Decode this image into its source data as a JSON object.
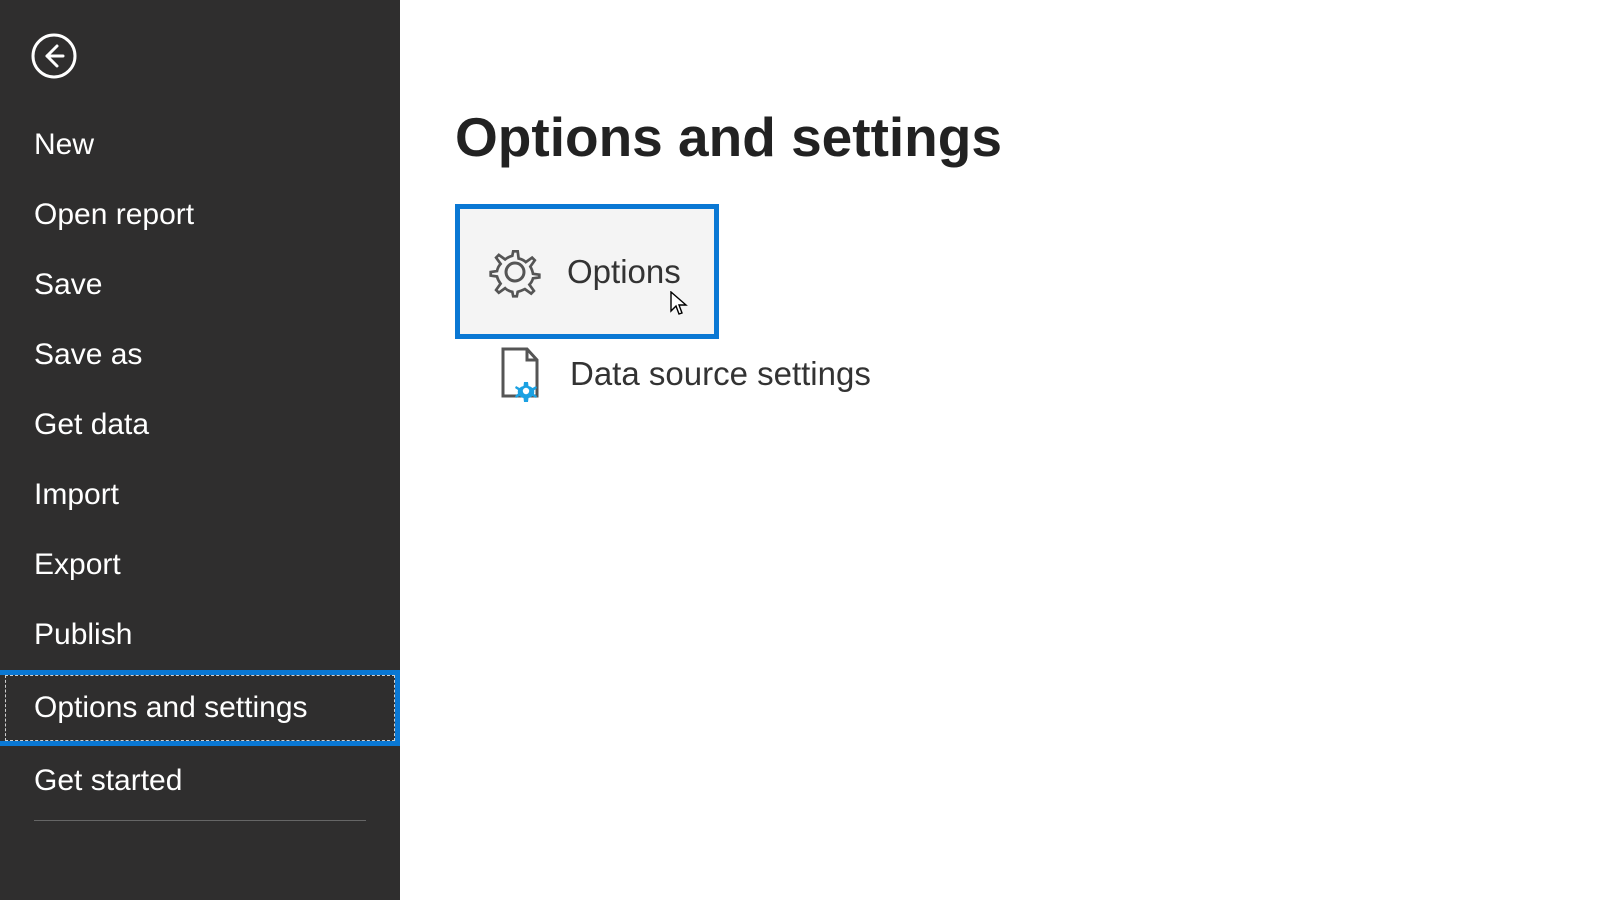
{
  "sidebar": {
    "items": [
      "New",
      "Open report",
      "Save",
      "Save as",
      "Get data",
      "Import",
      "Export",
      "Publish",
      "Options and settings",
      "Get started"
    ],
    "selected_index": 8
  },
  "main": {
    "title": "Options and settings",
    "options": [
      {
        "label": "Options"
      },
      {
        "label": "Data source settings"
      }
    ],
    "selected_option_index": 0
  }
}
